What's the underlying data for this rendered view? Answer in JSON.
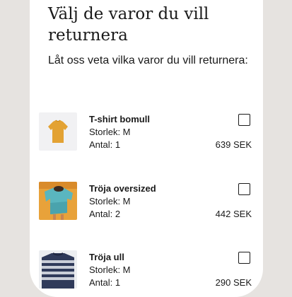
{
  "header": {
    "title": "Välj de varor du vill returnera",
    "subtitle": "Låt oss veta vilka varor du vill returnera:"
  },
  "items": [
    {
      "name": "T-shirt bomull",
      "size": "Storlek: M",
      "quantity": "Antal: 1",
      "price": "639 SEK",
      "image_icon": "tshirt-icon",
      "checked": false
    },
    {
      "name": "Tröja oversized",
      "size": "Storlek: M",
      "quantity": "Antal: 2",
      "price": "442 SEK",
      "image_icon": "sweater-oversized-icon",
      "checked": false
    },
    {
      "name": "Tröja ull",
      "size": "Storlek: M",
      "quantity": "Antal: 1",
      "price": "290 SEK",
      "image_icon": "wool-sweater-icon",
      "checked": false
    }
  ]
}
